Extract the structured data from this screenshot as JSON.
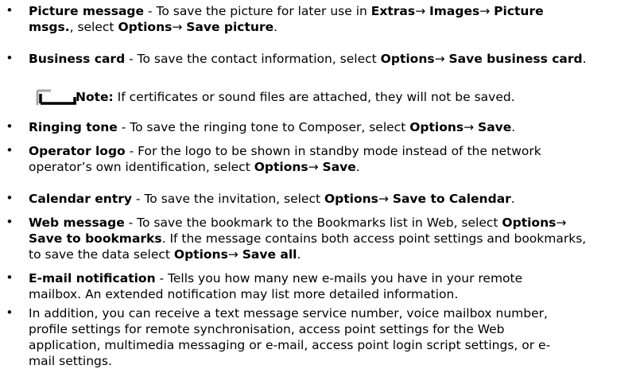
{
  "bullets": [
    {
      "lines": [
        [
          {
            "t": "Picture message",
            "b": true
          },
          {
            "t": " - To save the picture for later use in ",
            "b": false
          },
          {
            "t": "Extras",
            "b": true
          },
          {
            "t": "→ ",
            "b": false
          },
          {
            "t": "Images",
            "b": true
          },
          {
            "t": "→ ",
            "b": false
          },
          {
            "t": "Picture",
            "b": true
          }
        ],
        [
          {
            "t": "msgs.",
            "b": true
          },
          {
            "t": ", select ",
            "b": false
          },
          {
            "t": "Options",
            "b": true
          },
          {
            "t": "→ ",
            "b": false
          },
          {
            "t": "Save picture",
            "b": true
          },
          {
            "t": ".",
            "b": false
          }
        ]
      ]
    },
    {
      "lines": [
        [
          {
            "t": "Business card",
            "b": true
          },
          {
            "t": " - To save the contact information, select ",
            "b": false
          },
          {
            "t": "Options",
            "b": true
          },
          {
            "t": "→ ",
            "b": false
          },
          {
            "t": "Save business card",
            "b": true
          },
          {
            "t": ".",
            "b": false
          }
        ]
      ]
    },
    {
      "lines": [
        [
          {
            "t": "Ringing tone",
            "b": true
          },
          {
            "t": " - To save the ringing tone to Composer, select ",
            "b": false
          },
          {
            "t": "Options",
            "b": true
          },
          {
            "t": "→ ",
            "b": false
          },
          {
            "t": "Save",
            "b": true
          },
          {
            "t": ".",
            "b": false
          }
        ]
      ]
    },
    {
      "lines": [
        [
          {
            "t": "Operator logo",
            "b": true
          },
          {
            "t": " - For the logo to be shown in standby mode instead of the network",
            "b": false
          }
        ],
        [
          {
            "t": "operator’s own identification, select ",
            "b": false
          },
          {
            "t": "Options",
            "b": true
          },
          {
            "t": "→ ",
            "b": false
          },
          {
            "t": "Save",
            "b": true
          },
          {
            "t": ".",
            "b": false
          }
        ]
      ]
    },
    {
      "lines": [
        [
          {
            "t": "Calendar entry",
            "b": true
          },
          {
            "t": " - To save the invitation, select ",
            "b": false
          },
          {
            "t": "Options",
            "b": true
          },
          {
            "t": "→ ",
            "b": false
          },
          {
            "t": "Save to Calendar",
            "b": true
          },
          {
            "t": ".",
            "b": false
          }
        ]
      ]
    },
    {
      "lines": [
        [
          {
            "t": "Web message",
            "b": true
          },
          {
            "t": " - To save the bookmark to the Bookmarks list in Web, select ",
            "b": false
          },
          {
            "t": "Options",
            "b": true
          },
          {
            "t": "→",
            "b": false
          }
        ],
        [
          {
            "t": "Save to bookmarks",
            "b": true
          },
          {
            "t": ". If the message contains both access point settings and bookmarks,",
            "b": false
          }
        ],
        [
          {
            "t": "to save the data select ",
            "b": false
          },
          {
            "t": "Options",
            "b": true
          },
          {
            "t": "→ ",
            "b": false
          },
          {
            "t": "Save all",
            "b": true
          },
          {
            "t": ".",
            "b": false
          }
        ]
      ]
    },
    {
      "lines": [
        [
          {
            "t": "E-mail notification",
            "b": true
          },
          {
            "t": " - Tells you how many new e-mails you have in your remote",
            "b": false
          }
        ],
        [
          {
            "t": "mailbox. An extended notification may list more detailed information.",
            "b": false
          }
        ]
      ]
    },
    {
      "lines": [
        [
          {
            "t": "In addition, you can receive a text message service number, voice mailbox number,",
            "b": false
          }
        ],
        [
          {
            "t": "profile settings for remote synchronisation, access point settings for the Web",
            "b": false
          }
        ],
        [
          {
            "t": "application, multimedia messaging or e-mail, access point login script settings, or e-",
            "b": false
          }
        ],
        [
          {
            "t": "mail settings.",
            "b": false
          }
        ]
      ]
    }
  ],
  "bullet_char": "•",
  "note": {
    "icon": "note-icon",
    "label": "Note:",
    "text": " If certificates or sound files are attached, they will not be saved."
  }
}
